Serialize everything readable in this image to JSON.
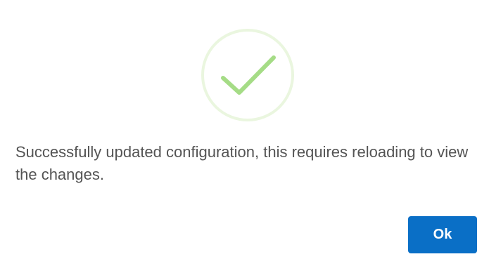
{
  "dialog": {
    "status_icon": "success-checkmark-icon",
    "message": "Successfully updated configuration, this requires reloading to view the changes.",
    "ok_label": "Ok"
  },
  "colors": {
    "success_ring": "#eaf6df",
    "success_check": "#a5dc86",
    "button_bg": "#0a6fc6",
    "button_text": "#ffffff",
    "message_text": "#545454"
  }
}
